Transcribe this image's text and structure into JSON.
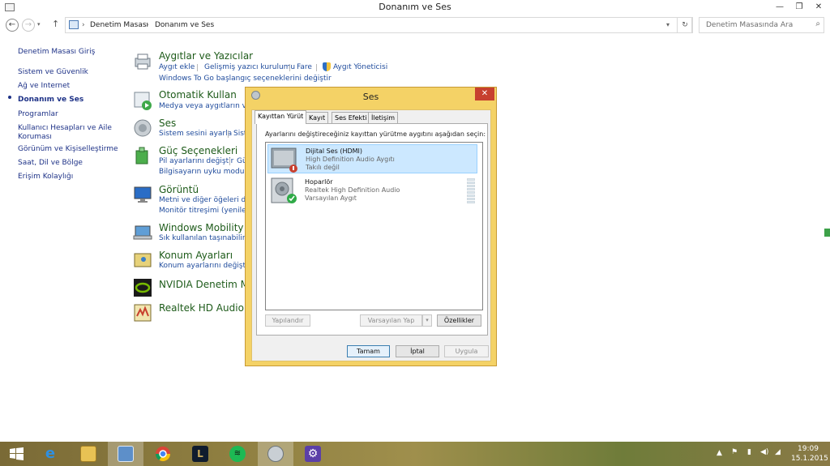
{
  "window": {
    "title": "Donanım ve Ses"
  },
  "address": {
    "crumbs": [
      "Denetim Masası",
      "Donanım ve Ses"
    ],
    "search_placeholder": "Denetim Masasında Ara"
  },
  "sidebar": {
    "items": [
      {
        "label": "Denetim Masası Giriş"
      },
      {
        "label": "Sistem ve Güvenlik"
      },
      {
        "label": "Ağ ve Internet"
      },
      {
        "label": "Donanım ve Ses"
      },
      {
        "label": "Programlar"
      },
      {
        "label": "Kullanıcı Hesapları ve Aile"
      },
      {
        "label": "Koruması"
      },
      {
        "label": "Görünüm ve Kişiselleştirme"
      },
      {
        "label": "Saat, Dil ve Bölge"
      },
      {
        "label": "Erişim Kolaylığı"
      }
    ]
  },
  "categories": [
    {
      "title": "Aygıtlar ve Yazıcılar",
      "links": [
        "Aygıt ekle",
        "Gelişmiş yazıcı kurulumu",
        "Fare",
        "Aygıt Yöneticisi",
        "Windows To Go başlangıç seçeneklerini değiştir"
      ]
    },
    {
      "title": "Otomatik Kullan",
      "links": [
        "Medya veya aygıtların varsa"
      ]
    },
    {
      "title": "Ses",
      "links": [
        "Sistem sesini ayarla",
        "Sist"
      ]
    },
    {
      "title": "Güç Seçenekleri",
      "links": [
        "Pil ayarlarını değiştir",
        "Gü",
        "Bilgisayarın uyku moduna"
      ]
    },
    {
      "title": "Görüntü",
      "links": [
        "Metni ve diğer öğeleri daha",
        "Monitör titreşimi (yenileme"
      ]
    },
    {
      "title": "Windows Mobility C",
      "links": [
        "Sık kullanılan taşınabilirlik a"
      ]
    },
    {
      "title": "Konum Ayarları",
      "links": [
        "Konum ayarlarını değiştir"
      ]
    },
    {
      "title": "NVIDIA Denetim Ma",
      "links": []
    },
    {
      "title": "Realtek HD Audio Yö",
      "links": []
    }
  ],
  "dialog": {
    "title": "Ses",
    "tabs": [
      "Kayıttan Yürüt",
      "Kayıt",
      "Ses Efekti",
      "İletişim"
    ],
    "instruction": "Ayarlarını değiştireceğiniz kayıttan yürütme aygıtını aşağıdan seçin:",
    "devices": [
      {
        "name": "Dijital Ses (HDMI)",
        "desc": "High Definition Audio Aygıtı",
        "status": "Takılı değil",
        "selected": true
      },
      {
        "name": "Hoparlör",
        "desc": "Realtek High Definition Audio",
        "status": "Varsayılan Aygıt",
        "selected": false
      }
    ],
    "buttons": {
      "configure": "Yapılandır",
      "set_default": "Varsayılan Yap",
      "properties": "Özellikler",
      "ok": "Tamam",
      "cancel": "İptal",
      "apply": "Uygula"
    }
  },
  "taskbar": {
    "clock_time": "19:09",
    "clock_date": "15.1.2015"
  }
}
